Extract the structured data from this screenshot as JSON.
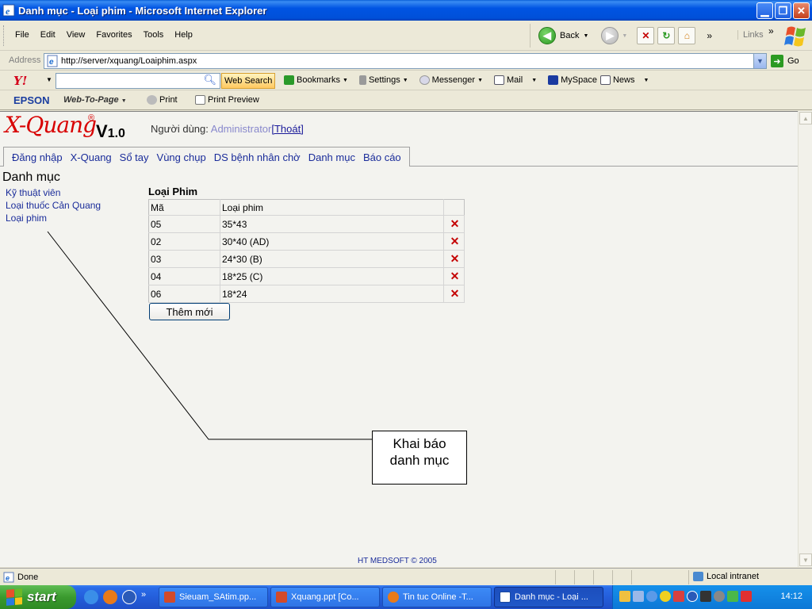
{
  "window": {
    "title": "Danh mục - Loại phim - Microsoft Internet Explorer"
  },
  "menu": [
    "File",
    "Edit",
    "View",
    "Favorites",
    "Tools",
    "Help"
  ],
  "toolbar": {
    "back_label": "Back",
    "links_label": "Links"
  },
  "address": {
    "label": "Address",
    "url": "http://server/xquang/Loaiphim.aspx",
    "go_label": "Go"
  },
  "yahoo": {
    "logo": "Y!",
    "search_placeholder": "",
    "web_search": "Web Search",
    "bookmarks": "Bookmarks",
    "settings": "Settings",
    "messenger": "Messenger",
    "mail": "Mail",
    "myspace": "MySpace",
    "news": "News"
  },
  "epson": {
    "brand": "EPSON",
    "web_to_page": "Web-To-Page",
    "print": "Print",
    "print_preview": "Print Preview"
  },
  "app": {
    "logo_text": "X-Quang",
    "logo_reg": "®",
    "version_v": "V",
    "version_num": "1.0",
    "user_label": "Người dùng: ",
    "user_name": "Administrator",
    "logout": "[Thoát]",
    "tabs": [
      "Đăng nhập",
      "X-Quang",
      "Sổ tay",
      "Vùng chụp",
      "DS bệnh nhân chờ",
      "Danh mục",
      "Báo cáo"
    ],
    "section_title": "Danh mục",
    "side_links": [
      "Kỹ thuật viên",
      "Loại thuốc Cản Quang",
      "Loại phim"
    ],
    "grid_title": "Loại Phim",
    "grid_headers": [
      "Mã",
      "Loại phim"
    ],
    "grid_rows": [
      {
        "code": "05",
        "name": "35*43"
      },
      {
        "code": "02",
        "name": "30*40 (AD)"
      },
      {
        "code": "03",
        "name": "24*30 (B)"
      },
      {
        "code": "04",
        "name": "18*25 (C)"
      },
      {
        "code": "06",
        "name": "18*24"
      }
    ],
    "delete_glyph": "✕",
    "add_button": "Thêm mới",
    "footer": "HT MEDSOFT © 2005"
  },
  "callout": {
    "line1": "Khai báo",
    "line2": "danh mục"
  },
  "status": {
    "done": "Done",
    "zone": "Local intranet"
  },
  "taskbar": {
    "start": "start",
    "tasks": [
      "Sieuam_SAtim.pp...",
      "Xquang.ppt [Co...",
      "Tin tuc Online -T...",
      "Danh mục - Loại ..."
    ],
    "clock": "14:12"
  },
  "colors": {
    "link": "#1a2c9a",
    "logo_red": "#d80000",
    "delete_red": "#c40000",
    "titlebar": "#0054e3"
  }
}
